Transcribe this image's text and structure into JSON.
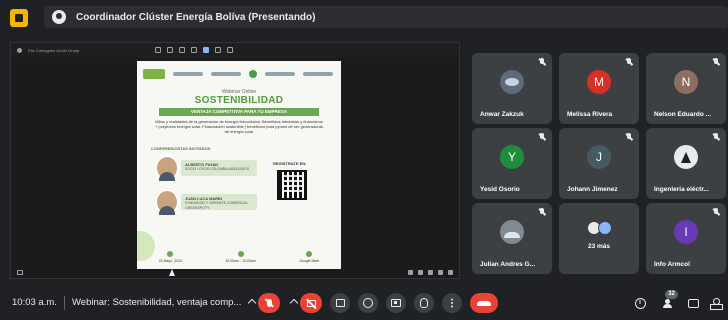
{
  "window": {
    "meeting_title": "Coordinador Clúster Energía Bolíva (Presentando)"
  },
  "presentation": {
    "toolbar_name": "Pac Coleagues Under Group",
    "flyer": {
      "webinar_label": "Webinar Online",
      "title": "SOSTENIBILIDAD",
      "band": "VENTAJA COMPETITIVA PARA TU EMPRESA",
      "description": "Mitos y realidades de la generación de energía fotovoltaica. Beneficios tributarios y financieros + proyectos energía solar. Financiación sostenible | beneficios para pymes de ser generadoras de energía solar",
      "conferencistas_label": "CONFERENCISTAS INVITADOS",
      "register_label": "REGÍSTRATE EN:",
      "speakers": [
        {
          "name": "ALBERTO FAYAD",
          "role": "SOCIO LOYDS COLOMBIA ABOGADOS"
        },
        {
          "name": "JUAN LUCA MARÍN",
          "role": "FUNDADOR Y GERENTE COMERCIAL GREENSPOTY"
        }
      ],
      "footer": [
        {
          "text": "23 Mayo, 2024"
        },
        {
          "text": "10:00am - 12:00am"
        },
        {
          "text": "Google Meet"
        }
      ]
    }
  },
  "participants": [
    {
      "name": "Anwar Zakzuk",
      "initial": "",
      "color": "#5f6b7a",
      "kind": "photo-anwar"
    },
    {
      "name": "Melissa Rivera",
      "initial": "M",
      "color": "#d93025",
      "kind": "initial"
    },
    {
      "name": "Nelson Eduardo ...",
      "initial": "N",
      "color": "#8d6e63",
      "kind": "initial"
    },
    {
      "name": "Yesid Osorio",
      "initial": "Y",
      "color": "#1e8e3e",
      "kind": "initial"
    },
    {
      "name": "Johann Jimenez",
      "initial": "J",
      "color": "#455a64",
      "kind": "initial"
    },
    {
      "name": "Ingenieria eléctr...",
      "initial": "",
      "color": "#e8eaed",
      "kind": "photo-ing"
    },
    {
      "name": "Julian Andres G...",
      "initial": "",
      "color": "#7e8a94",
      "kind": "photo-julian"
    },
    {
      "name": "23 más",
      "initial": "",
      "color": "#3c4043",
      "kind": "more"
    },
    {
      "name": "Info Armcol",
      "initial": "I",
      "color": "#673ab7",
      "kind": "initial"
    }
  ],
  "bottombar": {
    "time": "10:03 a.m.",
    "meeting_name": "Webinar: Sostenibilidad, ventaja comp...",
    "participant_count": "32"
  },
  "colors": {
    "background": "#202124",
    "tile": "#3c4043",
    "hangup": "#ea4335",
    "accent_green": "#4e9d3a"
  }
}
